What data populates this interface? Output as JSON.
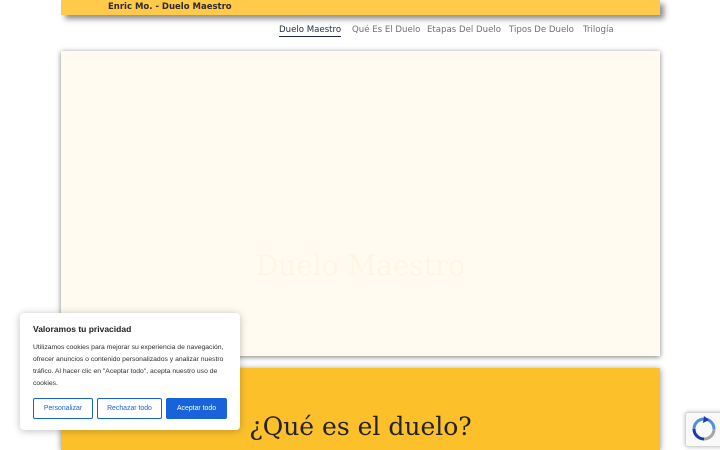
{
  "header": {
    "site_title": "Enric Mo. - Duelo Maestro"
  },
  "nav": {
    "items": [
      {
        "label": "Duelo Maestro",
        "active": true
      },
      {
        "label": "Qué Es El Duelo",
        "active": false
      },
      {
        "label": "Etapas Del Duelo",
        "active": false
      },
      {
        "label": "Tipos De Duelo",
        "active": false
      },
      {
        "label": "Trilogía",
        "active": false
      }
    ]
  },
  "hero": {
    "heading": "Duelo Maestro"
  },
  "section": {
    "title": "¿Qué es el duelo?"
  },
  "cookie_banner": {
    "title": "Valoramos tu privacidad",
    "text": "Utilizamos cookies para mejorar su experiencia de navegación, ofrecer anuncios o contenido personalizados y analizar nuestro tráfico. Al hacer clic en \"Aceptar todo\", acepta nuestro uso de cookies.",
    "customize_label": "Personalizar",
    "reject_label": "Rechazar todo",
    "accept_label": "Aceptar todo"
  },
  "recaptcha": {
    "icon": "recaptcha-icon"
  },
  "colors": {
    "accent_yellow": "#fcc12a",
    "hero_bg": "#fffbf1",
    "cookie_blue": "#1863dc",
    "recaptcha_blue": "#4a90e2"
  }
}
